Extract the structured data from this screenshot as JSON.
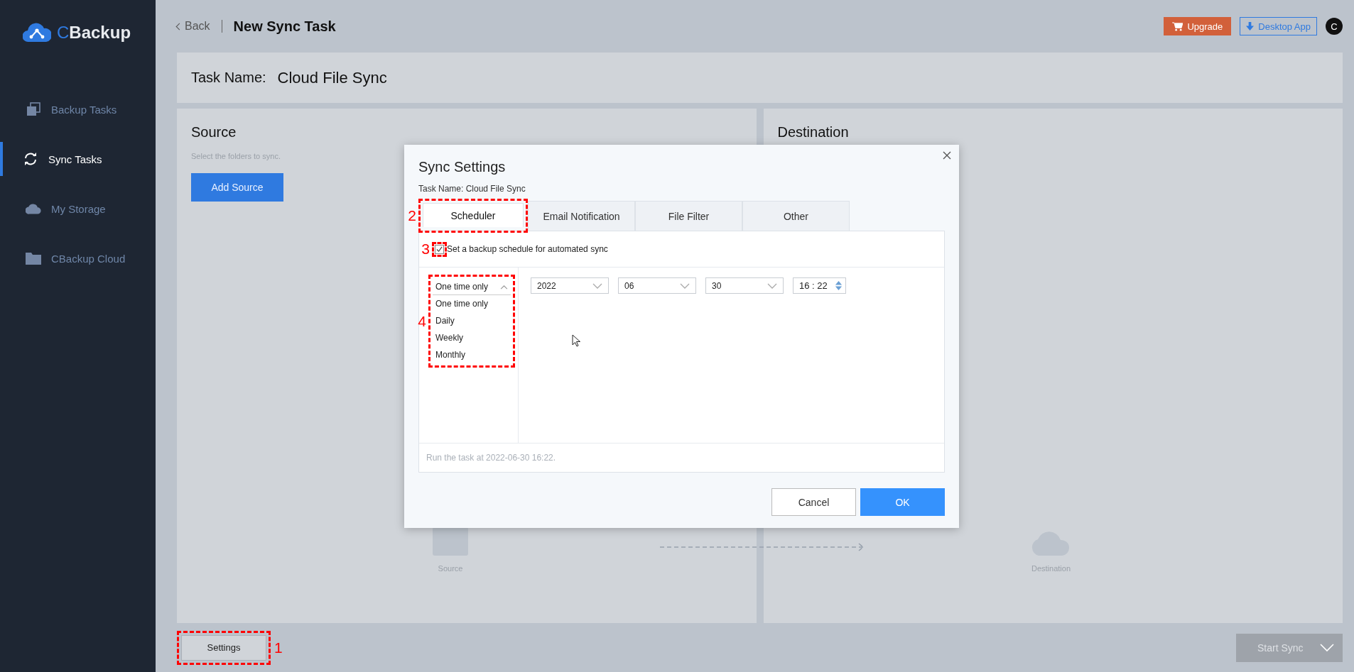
{
  "brand": {
    "name": "CBackup"
  },
  "sidebar": {
    "items": [
      {
        "label": "Backup Tasks",
        "kind": "copy",
        "selected": false
      },
      {
        "label": "Sync Tasks",
        "kind": "sync",
        "selected": true
      },
      {
        "label": "My Storage",
        "kind": "cloud",
        "selected": false
      },
      {
        "label": "CBackup Cloud",
        "kind": "folder",
        "selected": false
      }
    ]
  },
  "header": {
    "back": "Back",
    "title": "New Sync Task",
    "upgrade": "Upgrade",
    "desktop_app": "Desktop App",
    "avatar": "C"
  },
  "task_name": {
    "label": "Task Name:",
    "value": "Cloud File Sync"
  },
  "source": {
    "title": "Source",
    "hint": "Select the folders to sync.",
    "button": "Add Source",
    "caption": "Source"
  },
  "destination": {
    "title": "Destination",
    "caption": "Destination"
  },
  "dialog": {
    "title": "Sync Settings",
    "subtitle": "Task Name: Cloud File Sync",
    "tabs": [
      {
        "label": "Scheduler",
        "selected": true,
        "callout": "2"
      },
      {
        "label": "Email Notification",
        "selected": false
      },
      {
        "label": "File Filter",
        "selected": false
      },
      {
        "label": "Other",
        "selected": false
      }
    ],
    "schedule_checkbox": {
      "label": "Set a backup schedule for automated sync",
      "checked": true,
      "callout": "3"
    },
    "frequency": {
      "value": "One time only",
      "expanded": true,
      "callout": "4",
      "options": [
        "One time only",
        "Daily",
        "Weekly",
        "Monthly"
      ]
    },
    "date": {
      "year": "2022",
      "month": "06",
      "day": "30"
    },
    "time": "16 : 22",
    "summary": "Run the task at 2022-06-30 16:22.",
    "cancel": "Cancel",
    "ok": "OK"
  },
  "footer": {
    "settings": {
      "label": "Settings",
      "callout": "1"
    },
    "start_sync": {
      "label": "Start Sync",
      "disabled": true
    }
  }
}
